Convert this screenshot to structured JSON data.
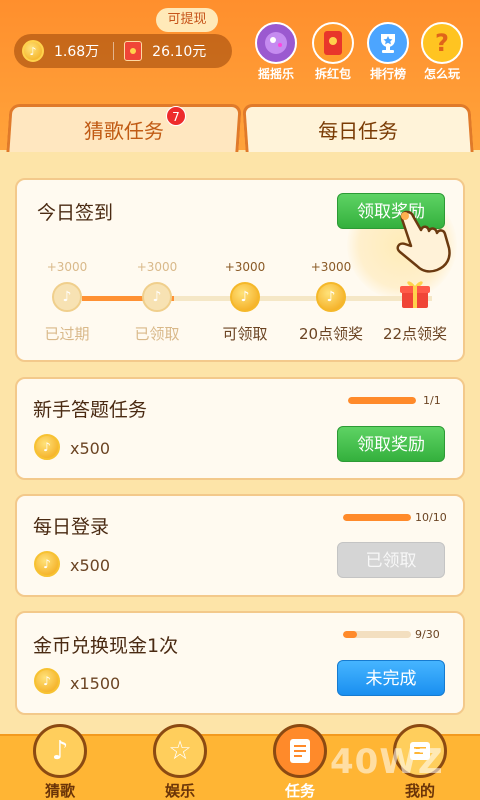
{
  "header": {
    "withdraw_tag": "可提现",
    "coins_balance": "1.68万",
    "cash_balance": "26.10元",
    "nav": [
      {
        "label": "摇摇乐",
        "icon": "ball-icon",
        "color": "#9b59d0"
      },
      {
        "label": "拆红包",
        "icon": "red-packet-icon",
        "color": "#ff9b2d"
      },
      {
        "label": "排行榜",
        "icon": "trophy-icon",
        "color": "#4ca5ff"
      },
      {
        "label": "怎么玩",
        "icon": "question-icon",
        "color": "#ffc421"
      }
    ]
  },
  "tabs": [
    {
      "label": "猜歌任务",
      "badge": "7"
    },
    {
      "label": "每日任务"
    }
  ],
  "checkin": {
    "title": "今日签到",
    "button": "领取奖励",
    "steps": [
      {
        "bonus": "+3000",
        "label": "已过期",
        "state": "past"
      },
      {
        "bonus": "+3000",
        "label": "已领取",
        "state": "claimed"
      },
      {
        "bonus": "+3000",
        "label": "可领取",
        "state": "available"
      },
      {
        "bonus": "+3000",
        "label": "20点领奖",
        "state": "future"
      },
      {
        "bonus": "",
        "label": "22点领奖",
        "state": "gift"
      }
    ]
  },
  "tasks": [
    {
      "title": "新手答题任务",
      "reward": "x500",
      "progress_text": "1/1",
      "progress": 1.0,
      "button": "领取奖励",
      "button_state": "claimable"
    },
    {
      "title": "每日登录",
      "reward": "x500",
      "progress_text": "10/10",
      "progress": 1.0,
      "button": "已领取",
      "button_state": "claimed"
    },
    {
      "title": "金币兑换现金1次",
      "reward": "x1500",
      "progress_text": "9/30",
      "progress": 0.1,
      "button": "未完成",
      "button_state": "incomplete"
    }
  ],
  "bottom_nav": [
    {
      "label": "猜歌",
      "icon": "music-note-icon",
      "active": false
    },
    {
      "label": "娱乐",
      "icon": "star-icon",
      "active": false
    },
    {
      "label": "任务",
      "icon": "task-list-icon",
      "active": true
    },
    {
      "label": "我的",
      "icon": "profile-icon",
      "active": false
    }
  ],
  "watermark": "40WZ"
}
